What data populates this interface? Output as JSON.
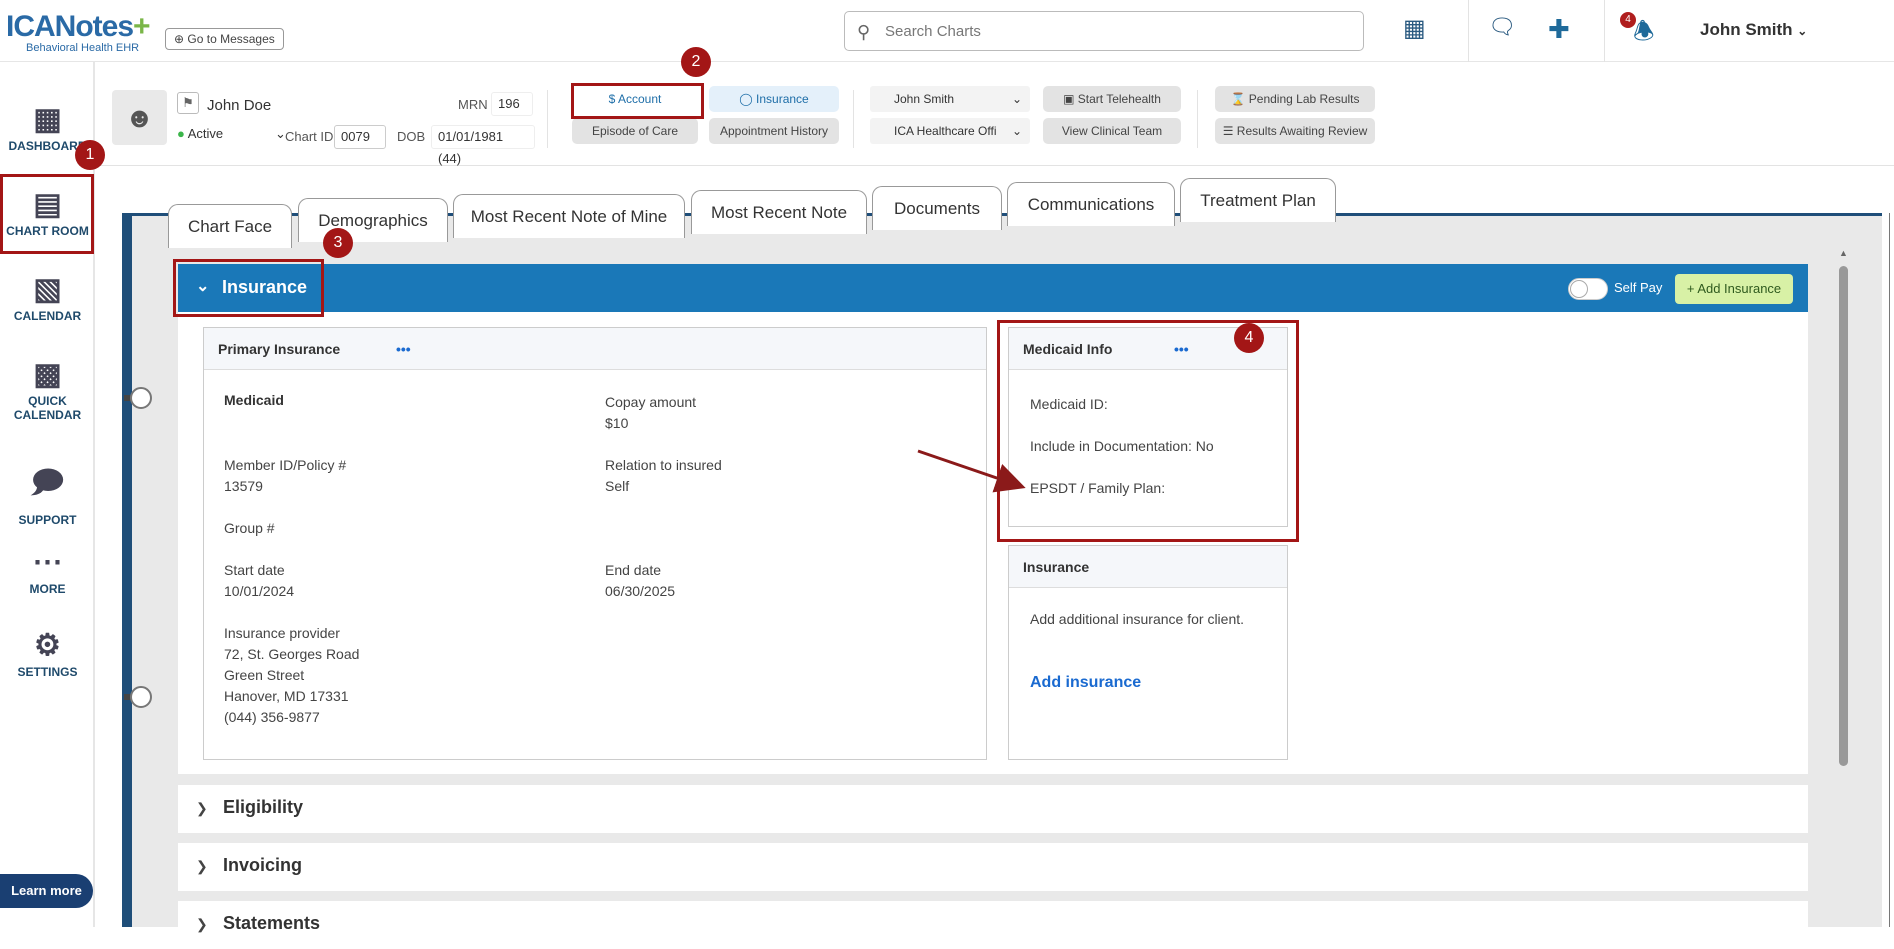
{
  "app": {
    "logo_main": "ICANotes",
    "logo_plus": "+",
    "logo_sub": "Behavioral Health EHR",
    "go_to_messages": "Go to Messages",
    "search_placeholder": "Search Charts",
    "notification_count": "4",
    "user_name": "John Smith"
  },
  "sidebar": {
    "items": [
      {
        "label": "DASHBOARD",
        "icon": "dashboard-icon"
      },
      {
        "label": "CHART ROOM",
        "icon": "chart-room-icon"
      },
      {
        "label": "CALENDAR",
        "icon": "calendar-icon"
      },
      {
        "label": "QUICK CALENDAR",
        "icon": "quick-calendar-icon"
      },
      {
        "label": "SUPPORT",
        "icon": "support-icon"
      },
      {
        "label": "MORE",
        "icon": "more-icon"
      },
      {
        "label": "SETTINGS",
        "icon": "settings-icon"
      }
    ],
    "learn_more": "Learn more"
  },
  "patient": {
    "name": "John Doe",
    "status": "Active",
    "mrn_label": "MRN",
    "mrn": "196",
    "chart_id_label": "Chart ID",
    "chart_id": "0079",
    "dob_label": "DOB",
    "dob": "01/01/1981 (44)",
    "btn_account": "Account",
    "btn_insurance": "Insurance",
    "btn_episode": "Episode of Care",
    "btn_appt_history": "Appointment History",
    "provider": "John Smith",
    "facility": "ICA Healthcare Offi",
    "btn_telehealth": "Start Telehealth",
    "btn_clinical_team": "View Clinical Team",
    "btn_pending_lab": "Pending Lab Results",
    "btn_results_review": "Results Awaiting Review"
  },
  "tabs": [
    "Chart Face",
    "Demographics",
    "Most Recent Note of Mine",
    "Most Recent Note",
    "Documents",
    "Communications",
    "Treatment Plan"
  ],
  "insurance_section": {
    "title": "Insurance",
    "self_pay": "Self Pay",
    "add_insurance_btn": "+ Add Insurance",
    "primary": {
      "title": "Primary Insurance",
      "dots": "•••",
      "plan": "Medicaid",
      "copay_label": "Copay amount",
      "copay": "$10",
      "member_label": "Member ID/Policy #",
      "member": "13579",
      "relation_label": "Relation to insured",
      "relation": "Self",
      "group_label": "Group #",
      "start_label": "Start date",
      "start": "10/01/2024",
      "end_label": "End date",
      "end": "06/30/2025",
      "provider_label": "Insurance provider",
      "provider_line1": "72, St. Georges Road",
      "provider_line2": "Green Street",
      "provider_line3": "Hanover, MD 17331",
      "provider_phone": "(044) 356-9877"
    },
    "medicaid": {
      "title": "Medicaid Info",
      "dots": "•••",
      "id_label": "Medicaid ID:",
      "include_doc": "Include in Documentation: No",
      "epsdt": "EPSDT / Family Plan:"
    },
    "add_card": {
      "title": "Insurance",
      "text": "Add additional insurance for client.",
      "link": "Add insurance"
    }
  },
  "sections": [
    "Eligibility",
    "Invoicing",
    "Statements"
  ],
  "callouts": [
    "1",
    "2",
    "3",
    "4"
  ],
  "colors": {
    "highlight": "#a31616",
    "header_blue": "#1a78b8",
    "link_blue": "#1a6ad0",
    "add_btn_green": "#d8f1a6"
  }
}
